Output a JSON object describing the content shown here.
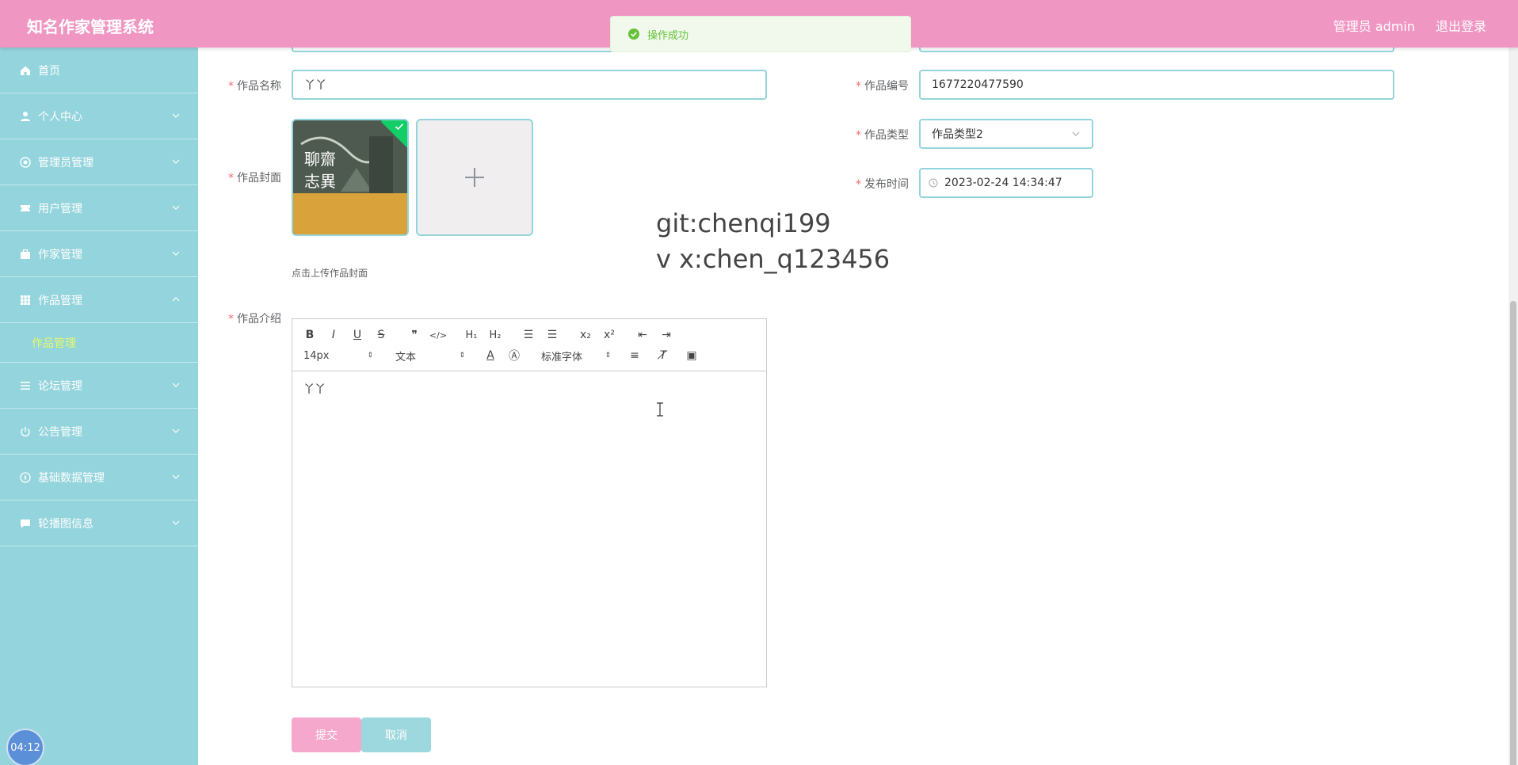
{
  "header": {
    "app_title": "知名作家管理系统",
    "admin": "管理员 admin",
    "logout": "退出登录"
  },
  "toast": {
    "message": "操作成功"
  },
  "sidebar": {
    "items": [
      {
        "label": "首页",
        "icon": "home-icon"
      },
      {
        "label": "个人中心",
        "icon": "user-icon"
      },
      {
        "label": "管理员管理",
        "icon": "admin-icon"
      },
      {
        "label": "用户管理",
        "icon": "ticket-icon"
      },
      {
        "label": "作家管理",
        "icon": "briefcase-icon"
      },
      {
        "label": "作品管理",
        "icon": "grid-icon",
        "expanded": true
      },
      {
        "label": "论坛管理",
        "icon": "list-icon"
      },
      {
        "label": "公告管理",
        "icon": "power-icon"
      },
      {
        "label": "基础数据管理",
        "icon": "compass-icon"
      },
      {
        "label": "轮播图信息",
        "icon": "chat-icon"
      }
    ],
    "subitem": "作品管理"
  },
  "form": {
    "name_label": "作品名称",
    "name_value": "丫丫",
    "number_label": "作品编号",
    "number_value": "1677220477590",
    "cover_label": "作品封面",
    "cover_hint": "点击上传作品封面",
    "type_label": "作品类型",
    "type_value": "作品类型2",
    "time_label": "发布时间",
    "time_value": "2023-02-24 14:34:47",
    "intro_label": "作品介绍",
    "intro_value": "丫丫",
    "submit": "提交",
    "cancel": "取消"
  },
  "editor_toolbar": {
    "font_size": "14px",
    "block": "文本",
    "font_family": "标准字体"
  },
  "watermark": {
    "line1": "git:chenqi199",
    "line2": "v x:chen_q123456"
  },
  "timer": "04:12",
  "colors": {
    "header": "#f096c2",
    "sidebar": "#94d4dc",
    "accent_sub": "#e6f76a",
    "submit": "#f5a8cb"
  }
}
